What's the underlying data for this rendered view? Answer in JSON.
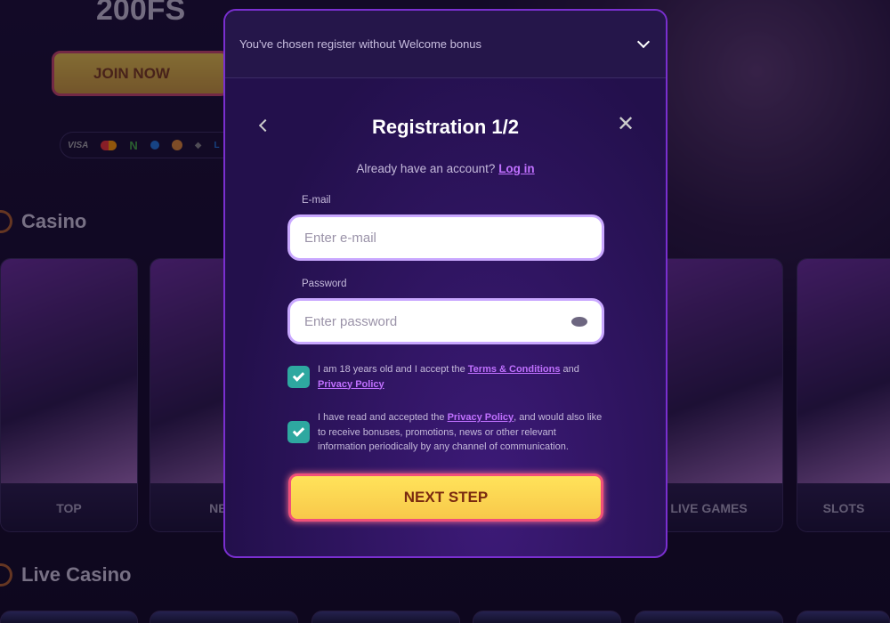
{
  "promo": {
    "title": "200FS",
    "join_label": "JOIN NOW",
    "payments": [
      "VISA",
      "mastercard",
      "N",
      "ripple",
      "bitcoin",
      "ethereum",
      "L"
    ]
  },
  "sections": {
    "casino": "Casino",
    "live_casino": "Live Casino"
  },
  "categories": [
    {
      "label": "TOP"
    },
    {
      "label": "NEW"
    },
    {
      "label": ""
    },
    {
      "label": ""
    },
    {
      "label": "LIVE GAMES"
    },
    {
      "label": "SLOTS"
    }
  ],
  "modal": {
    "bonus_banner": "You've chosen register without Welcome bonus",
    "title": "Registration 1/2",
    "have_account": "Already have an account?",
    "login_link": "Log in",
    "email_label": "E-mail",
    "email_placeholder": "Enter e-mail",
    "password_label": "Password",
    "password_placeholder": "Enter password",
    "consent1": {
      "checked": true,
      "pre": "I am 18 years old and I accept the ",
      "link1": "Terms & Conditions",
      "mid": " and ",
      "link2": "Privacy Policy"
    },
    "consent2": {
      "checked": true,
      "pre": "I have read and accepted the ",
      "link": "Privacy Policy",
      "post": ", and would also like to receive bonuses, promotions, news or other relevant information periodically by any channel of communication."
    },
    "next_label": "NEXT STEP"
  },
  "colors": {
    "accent": "#c070ff",
    "checkbox": "#2ea8a0",
    "modal_border": "#7a2fd0",
    "cta": "#ffe35a"
  }
}
